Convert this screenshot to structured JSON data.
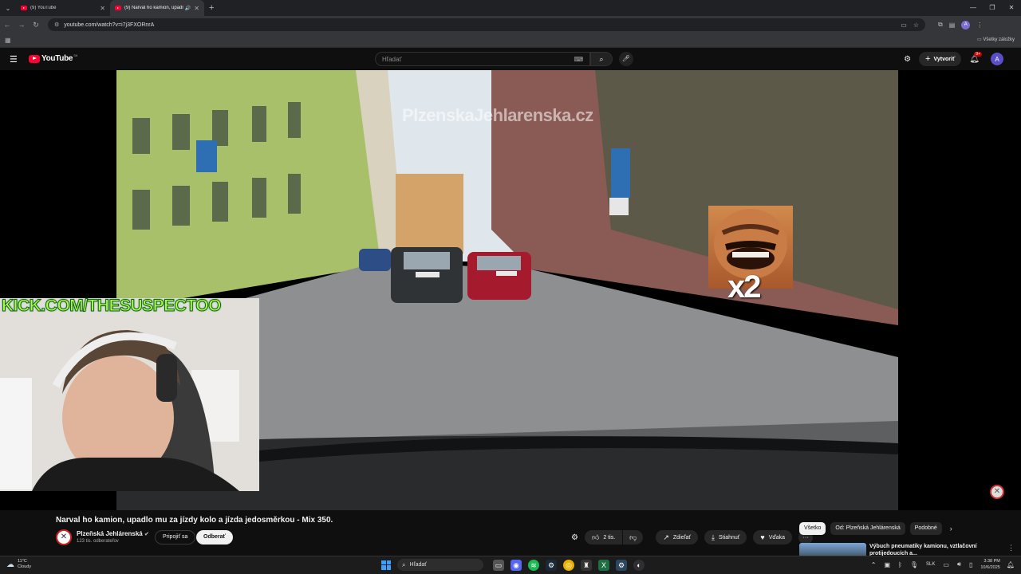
{
  "browser": {
    "tabs": [
      {
        "title": "(9) YouTube",
        "active": false
      },
      {
        "title": "(9) Narval ho kamion, upadl",
        "active": true
      }
    ],
    "new_tab_label": "+",
    "url": "youtube.com/watch?v=i7j3FXORnrA",
    "bookmarks_all": "Všetky záložky",
    "profile_initial": "A"
  },
  "youtube": {
    "logo_text": "YouTube",
    "country_code": "SK",
    "search_placeholder": "Hľadať",
    "create_label": "Vytvoriť",
    "notifications_badge": "9+",
    "avatar_initial": "A"
  },
  "video": {
    "watermark": "PlzenskaJehlarenska.cz",
    "meme_label": "x2",
    "overlay_text": "KICK.COM/THESUSPECTOO",
    "title": "Narval ho kamion, upadlo mu za jízdy kolo a jízda jedosměrkou - Mix 350."
  },
  "channel": {
    "name": "Plzeňská Jehlárenská",
    "verified_icon": "verified-icon",
    "subscribers": "123 tis. odberateľov",
    "join_label": "Pripojiť sa",
    "subscribe_label": "Odberať"
  },
  "actions": {
    "like_count": "2 tis.",
    "share_label": "Zdieľať",
    "download_label": "Stiahnuť",
    "thanks_label": "Vďaka",
    "more_label": "···"
  },
  "sidebar": {
    "chips": [
      {
        "label": "Všetko",
        "selected": true
      },
      {
        "label": "Od: Plzeňská Jehlárenská",
        "selected": false
      },
      {
        "label": "Podobné",
        "selected": false
      }
    ],
    "recommendation_title": "Výbuch pneumatiky kamionu, vztlačovní protijedoucích a..."
  },
  "taskbar": {
    "temperature": "11°C",
    "weather": "Cloudy",
    "search_placeholder": "Hľadať",
    "language": "SLK",
    "time": "3:38 PM",
    "date": "10/6/2025"
  },
  "colors": {
    "yt_red": "#ff0033",
    "kick_green": "#a8ff4a",
    "background": "#0f0f0f"
  }
}
